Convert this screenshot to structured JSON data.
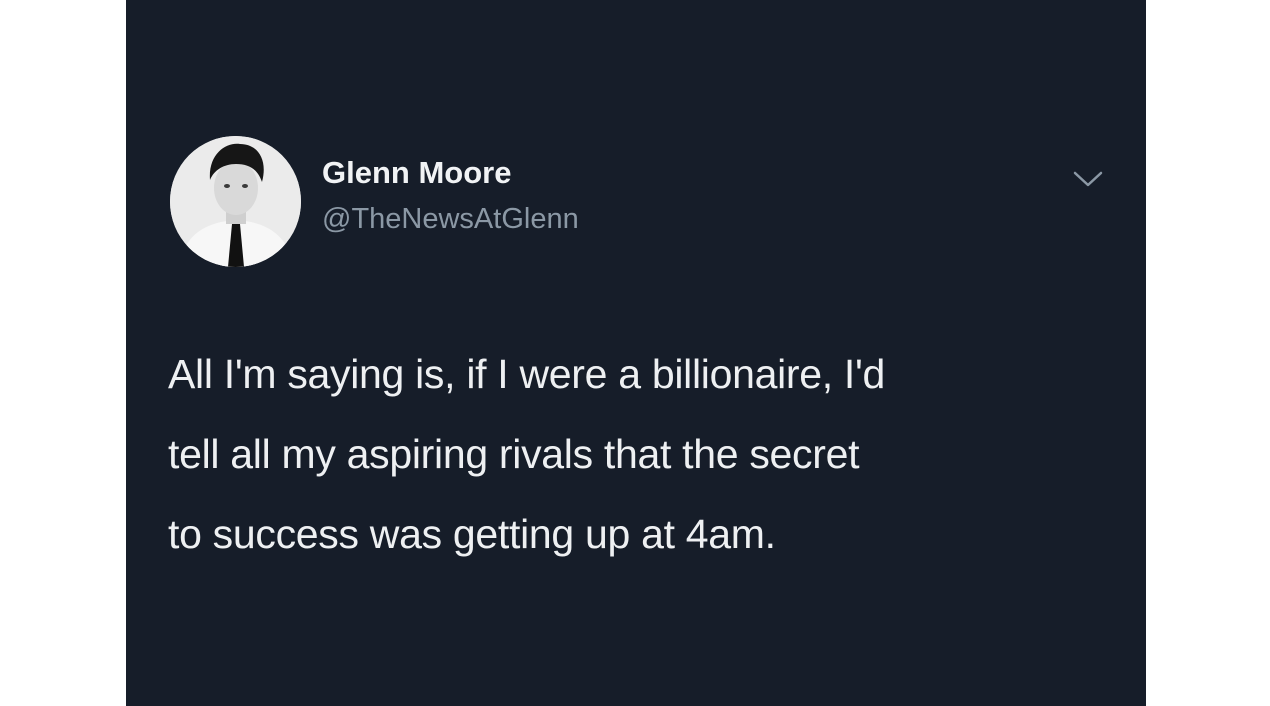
{
  "tweet": {
    "display_name": "Glenn Moore",
    "handle": "@TheNewsAtGlenn",
    "text_lines": [
      "All I'm saying is, if I were a billionaire, I'd",
      "tell all my aspiring rivals that the secret",
      "to success was getting up at 4am."
    ],
    "menu_icon": "chevron-down-icon",
    "avatar_icon": "profile-photo"
  },
  "colors": {
    "card_background": "#161d29",
    "name_text": "#f1f3f5",
    "handle_text": "#8b98a5",
    "body_text": "#eef0f2"
  }
}
